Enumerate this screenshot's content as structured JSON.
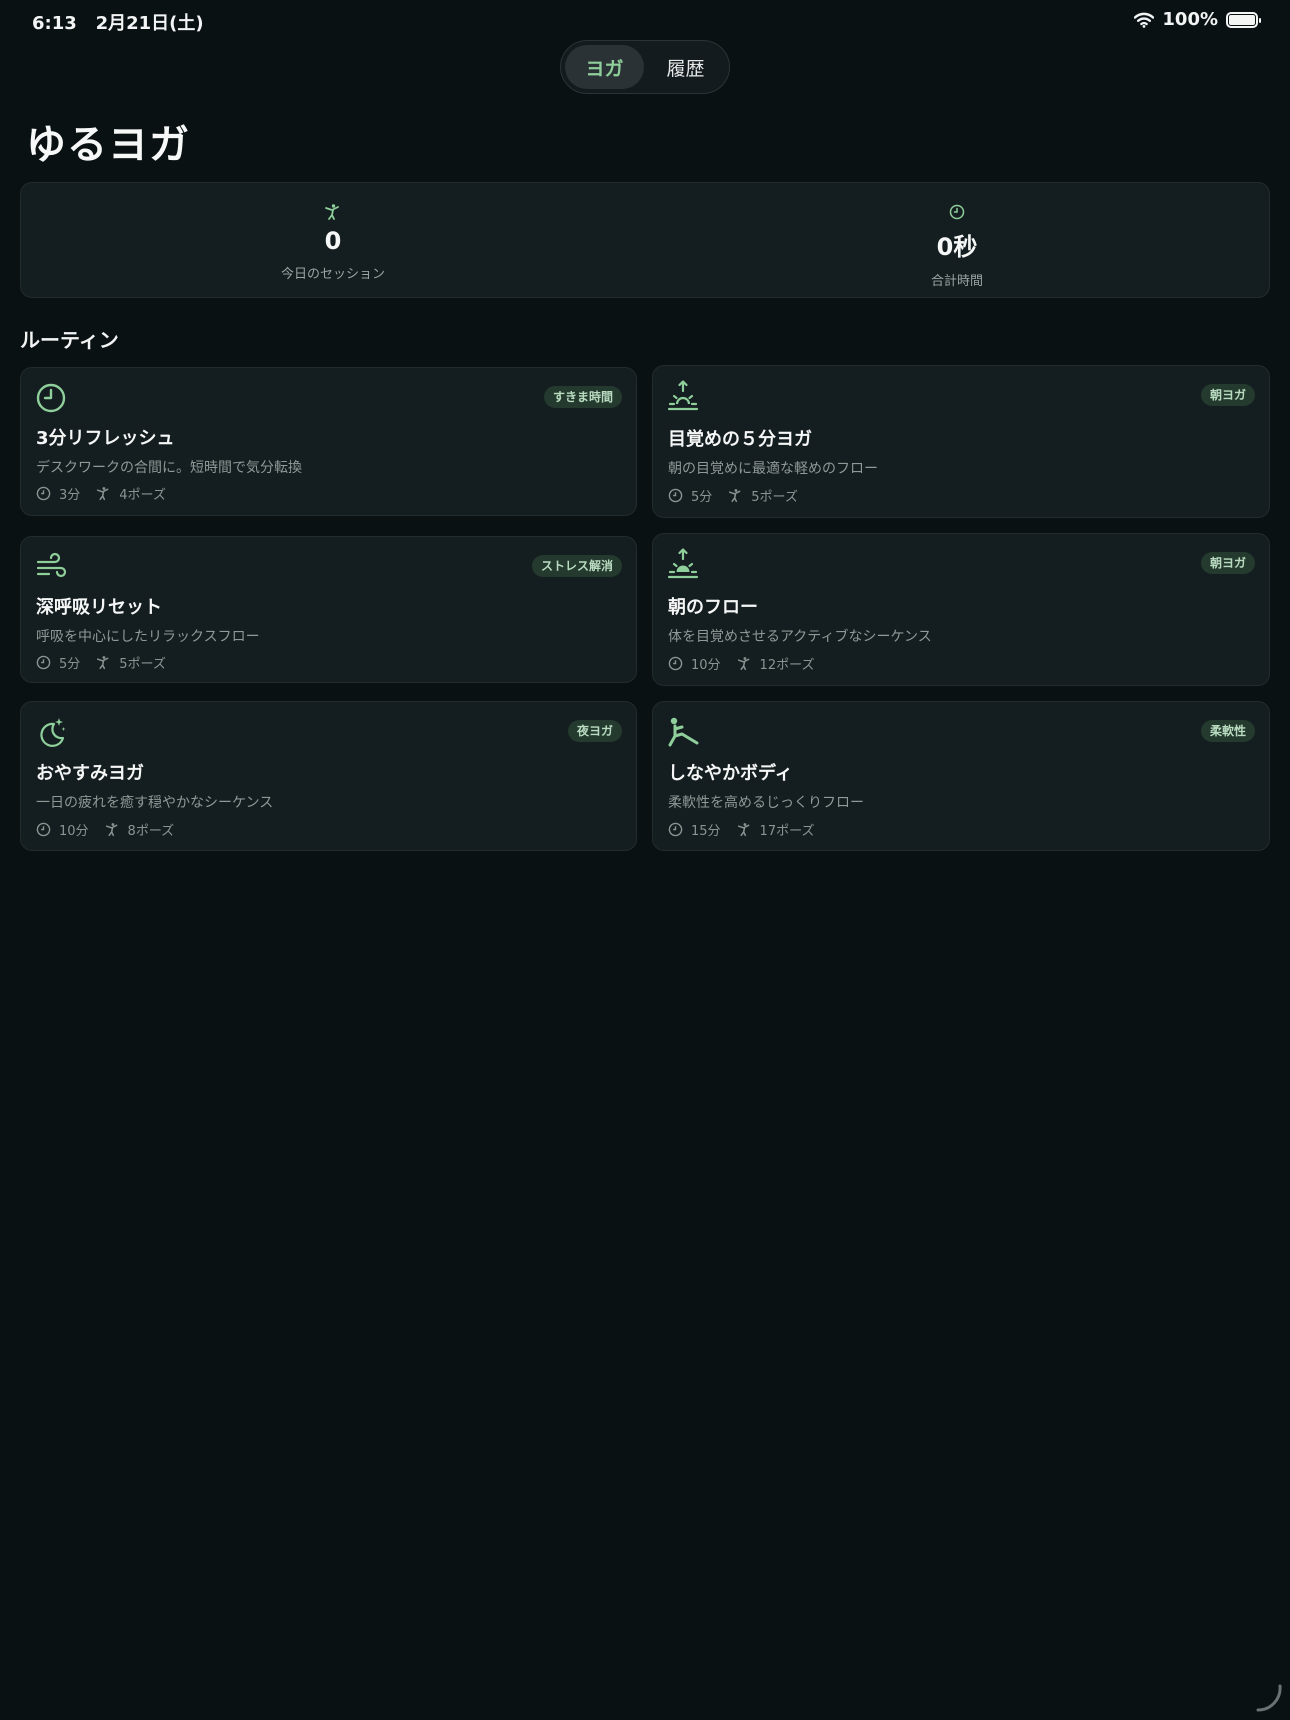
{
  "status_bar": {
    "time": "6:13",
    "date": "2月21日(土)",
    "battery": "100%"
  },
  "tabs": [
    {
      "label": "ヨガ",
      "active": true
    },
    {
      "label": "履歴",
      "active": false
    }
  ],
  "page_title": "ゆるヨガ",
  "stats": [
    {
      "icon": "yoga-pose-icon",
      "value": "0",
      "label": "今日のセッション"
    },
    {
      "icon": "clock-icon",
      "value": "0秒",
      "label": "合計時間"
    }
  ],
  "section_title": "ルーティン",
  "routines": [
    {
      "icon": "clock-icon",
      "badge": "すきま時間",
      "title": "3分リフレッシュ",
      "description": "デスクワークの合間に。短時間で気分転換",
      "duration": "3分",
      "poses": "4ポーズ"
    },
    {
      "icon": "sunrise-icon",
      "badge": "朝ヨガ",
      "title": "目覚めの５分ヨガ",
      "description": "朝の目覚めに最適な軽めのフロー",
      "duration": "5分",
      "poses": "5ポーズ"
    },
    {
      "icon": "wind-icon",
      "badge": "ストレス解消",
      "title": "深呼吸リセット",
      "description": "呼吸を中心にしたリラックスフロー",
      "duration": "5分",
      "poses": "5ポーズ"
    },
    {
      "icon": "sunrise-filled-icon",
      "badge": "朝ヨガ",
      "title": "朝のフロー",
      "description": "体を目覚めさせるアクティブなシーケンス",
      "duration": "10分",
      "poses": "12ポーズ"
    },
    {
      "icon": "moon-stars-icon",
      "badge": "夜ヨガ",
      "title": "おやすみヨガ",
      "description": "一日の疲れを癒す穏やかなシーケンス",
      "duration": "10分",
      "poses": "8ポーズ"
    },
    {
      "icon": "stretch-figure-icon",
      "badge": "柔軟性",
      "title": "しなやかボディ",
      "description": "柔軟性を高めるじっくりフロー",
      "duration": "15分",
      "poses": "17ポーズ"
    }
  ],
  "colors": {
    "background": "#0a1113",
    "card": "#141d1f",
    "accent": "#8fcf9b",
    "badge_bg": "#243a2e"
  }
}
